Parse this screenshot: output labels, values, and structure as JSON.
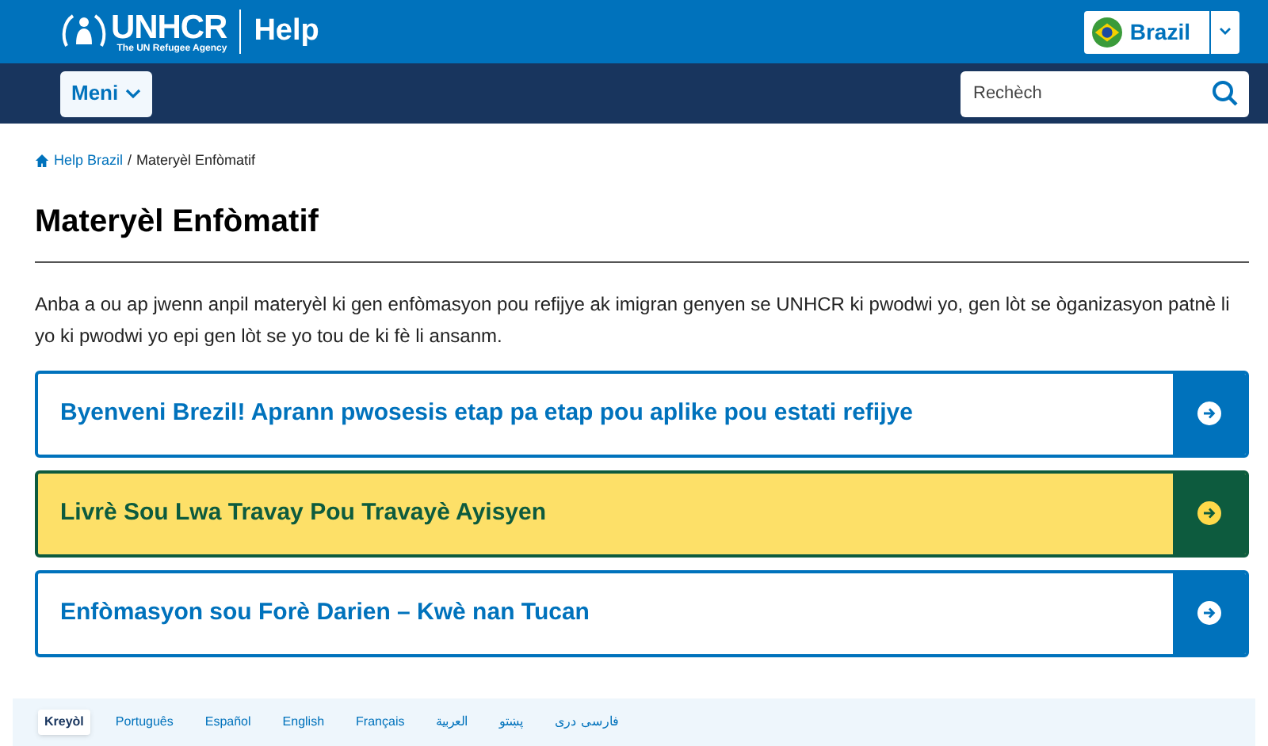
{
  "header": {
    "logo_name": "UNHCR",
    "logo_tagline": "The UN Refugee Agency",
    "site_title": "Help",
    "country": "Brazil"
  },
  "nav": {
    "menu_label": "Meni",
    "search": {
      "placeholder": "Rechèch"
    }
  },
  "breadcrumb": {
    "items": [
      "Help Brazil",
      "Materyèl Enfòmatif"
    ],
    "separator": "/"
  },
  "title": "Materyèl Enfòmatif",
  "intro": "Anba a ou ap jwenn anpil materyèl ki gen enfòmasyon pou refijye ak imigran genyen se UNHCR ki pwodwi yo, gen lòt se òganizasyon patnè li yo ki pwodwi yo epi gen lòt se yo tou de ki fè li ansanm.",
  "cards": [
    {
      "label": "Byenveni Brezil! Aprann pwosesis etap pa etap pou aplike pou estati refijye",
      "highlighted": false
    },
    {
      "label": "Livrè Sou Lwa Travay Pou Travayè Ayisyen",
      "highlighted": true
    },
    {
      "label": "Enfòmasyon sou Forè Darien  – Kwè nan Tucan",
      "highlighted": false
    }
  ],
  "languages": [
    {
      "label": "Kreyòl",
      "selected": true
    },
    {
      "label": "Português",
      "selected": false
    },
    {
      "label": "Español",
      "selected": false
    },
    {
      "label": "English",
      "selected": false
    },
    {
      "label": "Français",
      "selected": false
    },
    {
      "label": "العربية",
      "selected": false
    },
    {
      "label": "پښتو",
      "selected": false
    },
    {
      "label": "فارسی دری",
      "selected": false
    }
  ]
}
